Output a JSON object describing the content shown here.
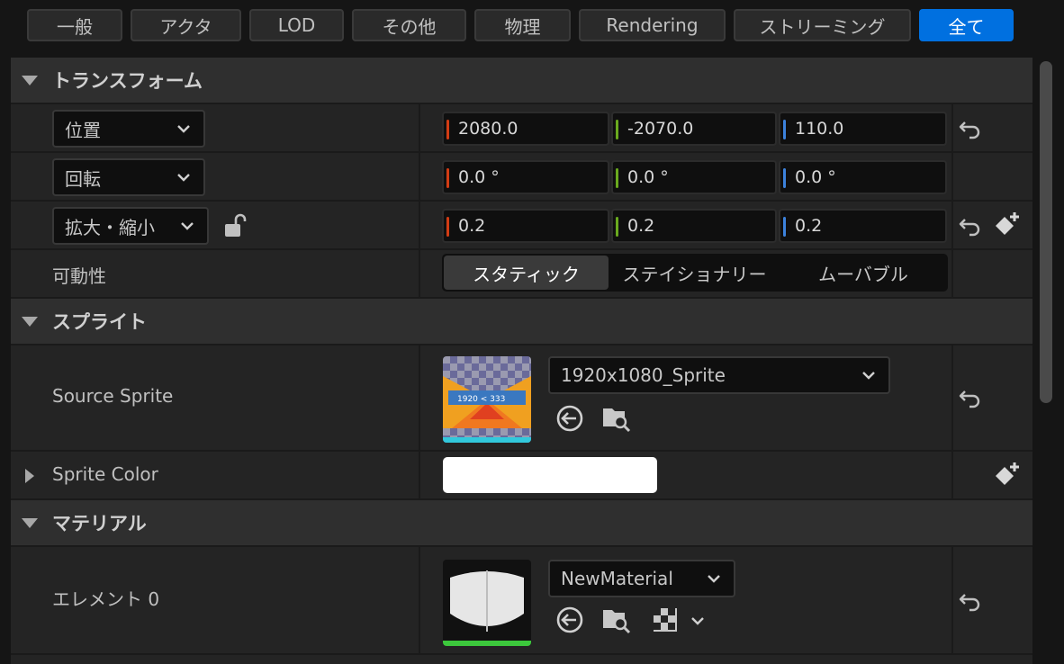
{
  "tabs": [
    {
      "label": "一般",
      "active": false
    },
    {
      "label": "アクタ",
      "active": false
    },
    {
      "label": "LOD",
      "active": false
    },
    {
      "label": "その他",
      "active": false
    },
    {
      "label": "物理",
      "active": false
    },
    {
      "label": "Rendering",
      "active": false
    },
    {
      "label": "ストリーミング",
      "active": false
    },
    {
      "label": "全て",
      "active": true
    }
  ],
  "sections": {
    "transform": "トランスフォーム",
    "sprite": "スプライト",
    "material": "マテリアル"
  },
  "transform": {
    "location": {
      "label": "位置",
      "x": "2080.0",
      "y": "-2070.0",
      "z": "110.0"
    },
    "rotation": {
      "label": "回転",
      "x": "0.0 °",
      "y": "0.0 °",
      "z": "0.0 °"
    },
    "scale": {
      "label": "拡大・縮小",
      "x": "0.2",
      "y": "0.2",
      "z": "0.2"
    },
    "mobility": {
      "label": "可動性",
      "options": [
        "スタティック",
        "ステイショナリー",
        "ムーバブル"
      ],
      "selected": "スタティック"
    }
  },
  "sprite": {
    "source_label": "Source Sprite",
    "source_value": "1920x1080_Sprite",
    "thumb_text": "1920 <    333",
    "color_label": "Sprite Color",
    "color_value": "#ffffff"
  },
  "material": {
    "element_label": "エレメント 0",
    "element_value": "NewMaterial"
  },
  "colors": {
    "accent": "#0070e0",
    "axis_x": "#d23c14",
    "axis_y": "#6aaa1e",
    "axis_z": "#3c82dc",
    "material_underline": "#3cc83c",
    "sprite_underline": "#32c8dc"
  }
}
